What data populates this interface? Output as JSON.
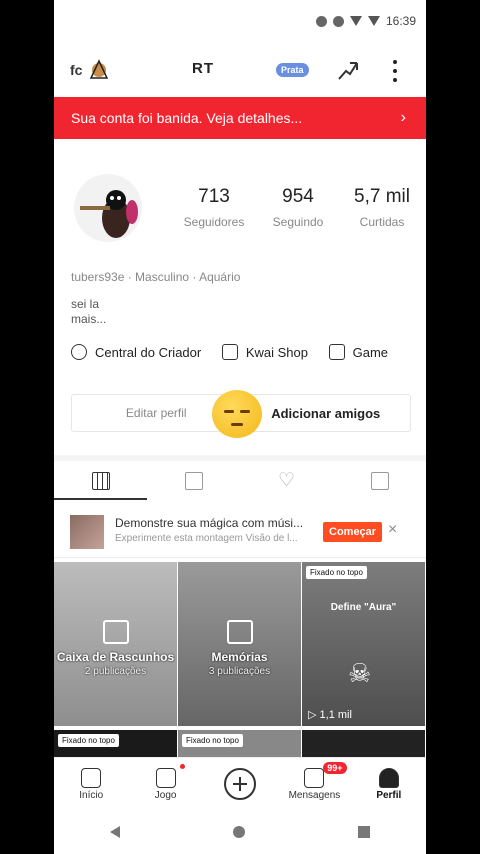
{
  "status_bar": {
    "time": "16:39"
  },
  "top_bar": {
    "left_name": "fc",
    "center_name": "RT",
    "rank_badge": "Prata"
  },
  "ban_banner": {
    "text": "Sua conta foi banida. Veja detalhes...",
    "chevron": "›"
  },
  "stats": [
    {
      "value": "713",
      "label": "Seguidores"
    },
    {
      "value": "954",
      "label": "Seguindo"
    },
    {
      "value": "5,7 mil",
      "label": "Curtidas"
    }
  ],
  "profile_meta": "tubers93e · Masculino · Aquário",
  "bio": "sei la\nmais...",
  "links": [
    {
      "label": "Central do Criador",
      "icon": "lightning-icon"
    },
    {
      "label": "Kwai Shop",
      "icon": "shopping-bag-icon"
    },
    {
      "label": "Game",
      "icon": "gamepad-icon"
    }
  ],
  "buttons": {
    "edit_profile": "Editar perfil",
    "add_friends": "Adicionar amigos"
  },
  "tabs": [
    "grid",
    "lock",
    "heart",
    "bookmark"
  ],
  "promo": {
    "title": "Demonstre sua mágica com músi...",
    "subtitle": "Experimente esta montagem Visão de l...",
    "cta": "Começar",
    "close": "×"
  },
  "grid_cells": [
    {
      "title": "Caixa de Rascunhos",
      "subtitle": "2 publicações"
    },
    {
      "title": "Memórias",
      "subtitle": "3 publicações"
    },
    {
      "pinned": "Fixado no topo",
      "video_text": "Define \"Aura\"",
      "views": "1,1 mil"
    }
  ],
  "grid_row2_pins": [
    "Fixado no topo",
    "Fixado no topo"
  ],
  "bottom_nav": [
    {
      "label": "Início",
      "icon": "home-icon"
    },
    {
      "label": "Jogo",
      "icon": "game-icon"
    },
    {
      "label": "",
      "icon": "plus-icon"
    },
    {
      "label": "Mensagens",
      "icon": "bell-icon",
      "badge": "99+"
    },
    {
      "label": "Perfil",
      "icon": "profile-icon"
    }
  ],
  "colors": {
    "accent": "#f1252f",
    "cta": "#fe4d22",
    "badge_blue": "#6a8fe0"
  }
}
